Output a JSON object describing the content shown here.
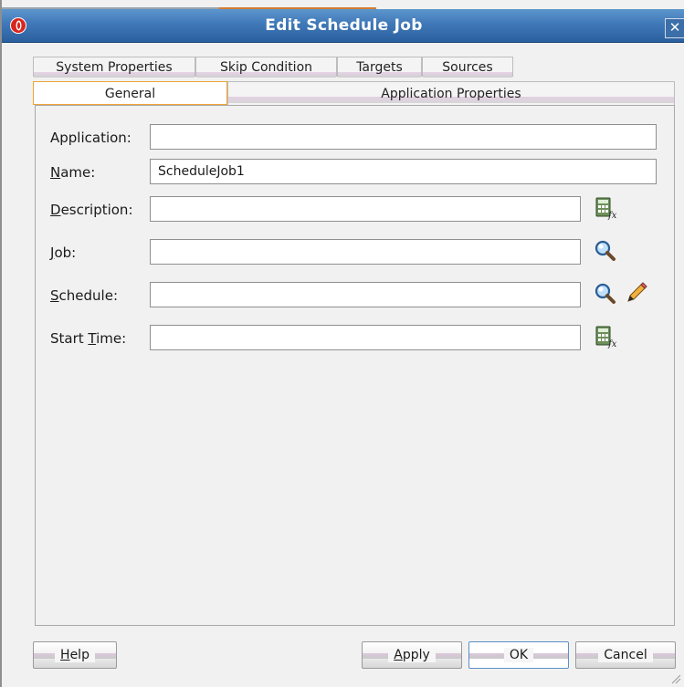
{
  "window": {
    "title": "Edit Schedule Job",
    "close_glyph": "✕"
  },
  "tabs_row1": [
    {
      "label": "System Properties"
    },
    {
      "label": "Skip Condition"
    },
    {
      "label": "Targets"
    },
    {
      "label": "Sources"
    }
  ],
  "tabs_row2": [
    {
      "label": "General",
      "selected": true
    },
    {
      "label": "Application Properties",
      "selected": false
    }
  ],
  "form": {
    "application": {
      "label": "Application:",
      "value": ""
    },
    "name": {
      "label_prefix": "",
      "label_mnemonic": "N",
      "label_rest": "ame:",
      "value": "ScheduleJob1"
    },
    "description": {
      "label_mnemonic": "D",
      "label_rest": "escription:",
      "value": "",
      "icon": "expression-builder-icon"
    },
    "job": {
      "label_mnemonic": "J",
      "label_rest": "ob:",
      "value": "",
      "icon": "search-icon"
    },
    "schedule": {
      "label_mnemonic": "S",
      "label_rest": "chedule:",
      "value": "",
      "icons": [
        "search-icon",
        "edit-pencil-icon"
      ]
    },
    "start_time": {
      "label_prefix": "Start ",
      "label_mnemonic": "T",
      "label_rest": "ime:",
      "value": "",
      "icon": "expression-builder-icon"
    }
  },
  "buttons": {
    "help": {
      "mnemonic": "H",
      "rest": "elp"
    },
    "apply": {
      "mnemonic": "A",
      "rest": "pply"
    },
    "ok": {
      "label": "OK"
    },
    "cancel": {
      "label": "Cancel"
    }
  },
  "colors": {
    "titlebar": "#3f78b8",
    "selected_tab_border": "#f0a434",
    "focus_border": "#5a8fc7"
  }
}
